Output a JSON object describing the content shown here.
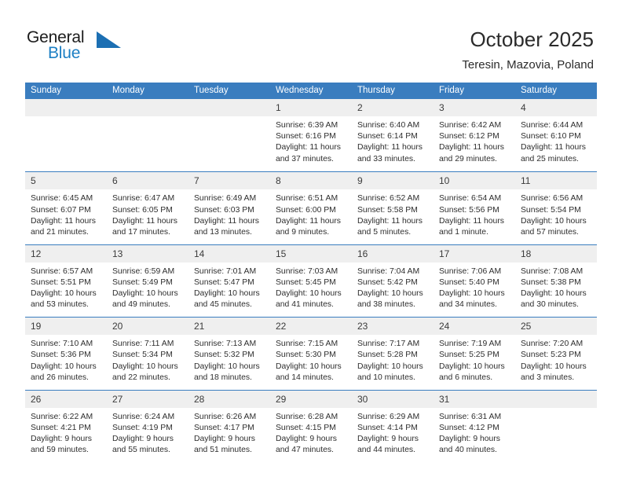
{
  "brand": {
    "name_part1": "General",
    "name_part2": "Blue",
    "triangle_icon": "triangle-icon",
    "color_dark": "#1b1b1b",
    "color_blue": "#1c7fc4"
  },
  "header": {
    "title": "October 2025",
    "subtitle": "Teresin, Mazovia, Poland"
  },
  "theme": {
    "header_blue": "#3a7dbf",
    "day_band_gray": "#efefef",
    "text": "#2e2e2e"
  },
  "weekdays": [
    "Sunday",
    "Monday",
    "Tuesday",
    "Wednesday",
    "Thursday",
    "Friday",
    "Saturday"
  ],
  "weeks": [
    [
      {
        "day": "",
        "empty": true,
        "lines": []
      },
      {
        "day": "",
        "empty": true,
        "lines": []
      },
      {
        "day": "",
        "empty": true,
        "lines": []
      },
      {
        "day": "1",
        "empty": false,
        "lines": [
          "Sunrise: 6:39 AM",
          "Sunset: 6:16 PM",
          "Daylight: 11 hours",
          "and 37 minutes."
        ]
      },
      {
        "day": "2",
        "empty": false,
        "lines": [
          "Sunrise: 6:40 AM",
          "Sunset: 6:14 PM",
          "Daylight: 11 hours",
          "and 33 minutes."
        ]
      },
      {
        "day": "3",
        "empty": false,
        "lines": [
          "Sunrise: 6:42 AM",
          "Sunset: 6:12 PM",
          "Daylight: 11 hours",
          "and 29 minutes."
        ]
      },
      {
        "day": "4",
        "empty": false,
        "lines": [
          "Sunrise: 6:44 AM",
          "Sunset: 6:10 PM",
          "Daylight: 11 hours",
          "and 25 minutes."
        ]
      }
    ],
    [
      {
        "day": "5",
        "empty": false,
        "lines": [
          "Sunrise: 6:45 AM",
          "Sunset: 6:07 PM",
          "Daylight: 11 hours",
          "and 21 minutes."
        ]
      },
      {
        "day": "6",
        "empty": false,
        "lines": [
          "Sunrise: 6:47 AM",
          "Sunset: 6:05 PM",
          "Daylight: 11 hours",
          "and 17 minutes."
        ]
      },
      {
        "day": "7",
        "empty": false,
        "lines": [
          "Sunrise: 6:49 AM",
          "Sunset: 6:03 PM",
          "Daylight: 11 hours",
          "and 13 minutes."
        ]
      },
      {
        "day": "8",
        "empty": false,
        "lines": [
          "Sunrise: 6:51 AM",
          "Sunset: 6:00 PM",
          "Daylight: 11 hours",
          "and 9 minutes."
        ]
      },
      {
        "day": "9",
        "empty": false,
        "lines": [
          "Sunrise: 6:52 AM",
          "Sunset: 5:58 PM",
          "Daylight: 11 hours",
          "and 5 minutes."
        ]
      },
      {
        "day": "10",
        "empty": false,
        "lines": [
          "Sunrise: 6:54 AM",
          "Sunset: 5:56 PM",
          "Daylight: 11 hours",
          "and 1 minute."
        ]
      },
      {
        "day": "11",
        "empty": false,
        "lines": [
          "Sunrise: 6:56 AM",
          "Sunset: 5:54 PM",
          "Daylight: 10 hours",
          "and 57 minutes."
        ]
      }
    ],
    [
      {
        "day": "12",
        "empty": false,
        "lines": [
          "Sunrise: 6:57 AM",
          "Sunset: 5:51 PM",
          "Daylight: 10 hours",
          "and 53 minutes."
        ]
      },
      {
        "day": "13",
        "empty": false,
        "lines": [
          "Sunrise: 6:59 AM",
          "Sunset: 5:49 PM",
          "Daylight: 10 hours",
          "and 49 minutes."
        ]
      },
      {
        "day": "14",
        "empty": false,
        "lines": [
          "Sunrise: 7:01 AM",
          "Sunset: 5:47 PM",
          "Daylight: 10 hours",
          "and 45 minutes."
        ]
      },
      {
        "day": "15",
        "empty": false,
        "lines": [
          "Sunrise: 7:03 AM",
          "Sunset: 5:45 PM",
          "Daylight: 10 hours",
          "and 41 minutes."
        ]
      },
      {
        "day": "16",
        "empty": false,
        "lines": [
          "Sunrise: 7:04 AM",
          "Sunset: 5:42 PM",
          "Daylight: 10 hours",
          "and 38 minutes."
        ]
      },
      {
        "day": "17",
        "empty": false,
        "lines": [
          "Sunrise: 7:06 AM",
          "Sunset: 5:40 PM",
          "Daylight: 10 hours",
          "and 34 minutes."
        ]
      },
      {
        "day": "18",
        "empty": false,
        "lines": [
          "Sunrise: 7:08 AM",
          "Sunset: 5:38 PM",
          "Daylight: 10 hours",
          "and 30 minutes."
        ]
      }
    ],
    [
      {
        "day": "19",
        "empty": false,
        "lines": [
          "Sunrise: 7:10 AM",
          "Sunset: 5:36 PM",
          "Daylight: 10 hours",
          "and 26 minutes."
        ]
      },
      {
        "day": "20",
        "empty": false,
        "lines": [
          "Sunrise: 7:11 AM",
          "Sunset: 5:34 PM",
          "Daylight: 10 hours",
          "and 22 minutes."
        ]
      },
      {
        "day": "21",
        "empty": false,
        "lines": [
          "Sunrise: 7:13 AM",
          "Sunset: 5:32 PM",
          "Daylight: 10 hours",
          "and 18 minutes."
        ]
      },
      {
        "day": "22",
        "empty": false,
        "lines": [
          "Sunrise: 7:15 AM",
          "Sunset: 5:30 PM",
          "Daylight: 10 hours",
          "and 14 minutes."
        ]
      },
      {
        "day": "23",
        "empty": false,
        "lines": [
          "Sunrise: 7:17 AM",
          "Sunset: 5:28 PM",
          "Daylight: 10 hours",
          "and 10 minutes."
        ]
      },
      {
        "day": "24",
        "empty": false,
        "lines": [
          "Sunrise: 7:19 AM",
          "Sunset: 5:25 PM",
          "Daylight: 10 hours",
          "and 6 minutes."
        ]
      },
      {
        "day": "25",
        "empty": false,
        "lines": [
          "Sunrise: 7:20 AM",
          "Sunset: 5:23 PM",
          "Daylight: 10 hours",
          "and 3 minutes."
        ]
      }
    ],
    [
      {
        "day": "26",
        "empty": false,
        "lines": [
          "Sunrise: 6:22 AM",
          "Sunset: 4:21 PM",
          "Daylight: 9 hours",
          "and 59 minutes."
        ]
      },
      {
        "day": "27",
        "empty": false,
        "lines": [
          "Sunrise: 6:24 AM",
          "Sunset: 4:19 PM",
          "Daylight: 9 hours",
          "and 55 minutes."
        ]
      },
      {
        "day": "28",
        "empty": false,
        "lines": [
          "Sunrise: 6:26 AM",
          "Sunset: 4:17 PM",
          "Daylight: 9 hours",
          "and 51 minutes."
        ]
      },
      {
        "day": "29",
        "empty": false,
        "lines": [
          "Sunrise: 6:28 AM",
          "Sunset: 4:15 PM",
          "Daylight: 9 hours",
          "and 47 minutes."
        ]
      },
      {
        "day": "30",
        "empty": false,
        "lines": [
          "Sunrise: 6:29 AM",
          "Sunset: 4:14 PM",
          "Daylight: 9 hours",
          "and 44 minutes."
        ]
      },
      {
        "day": "31",
        "empty": false,
        "lines": [
          "Sunrise: 6:31 AM",
          "Sunset: 4:12 PM",
          "Daylight: 9 hours",
          "and 40 minutes."
        ]
      },
      {
        "day": "",
        "empty": true,
        "lines": []
      }
    ]
  ]
}
